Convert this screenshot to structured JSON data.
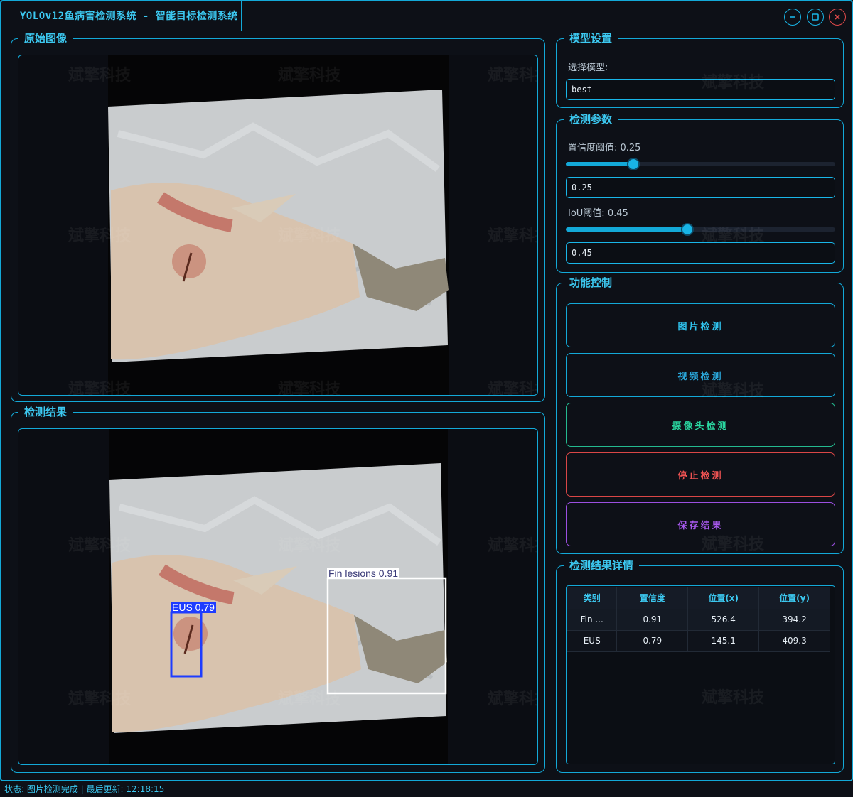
{
  "window": {
    "title": "YOLOv12鱼病害检测系统 - 智能目标检测系统"
  },
  "original_panel": {
    "title": "原始图像"
  },
  "result_panel": {
    "title": "检测结果",
    "detections": [
      {
        "label": "EUS 0.79",
        "color": "#1e3cff"
      },
      {
        "label": "Fin lesions 0.91",
        "color": "#ffffff"
      }
    ]
  },
  "model_settings": {
    "title": "模型设置",
    "select_label": "选择模型:",
    "selected_model": "best"
  },
  "detect_params": {
    "title": "检测参数",
    "conf_label": "置信度阈值: 0.25",
    "conf_value": "0.25",
    "conf_fraction": 0.25,
    "iou_label": "IoU阈值: 0.45",
    "iou_value": "0.45",
    "iou_fraction": 0.45
  },
  "controls": {
    "title": "功能控制",
    "buttons": [
      {
        "label": "图片检测",
        "color": "#2fc4f0"
      },
      {
        "label": "视频检测",
        "color": "#2aa6d9"
      },
      {
        "label": "摄像头检测",
        "color": "#2ad6a0"
      },
      {
        "label": "停止检测",
        "color": "#ee5252"
      },
      {
        "label": "保存结果",
        "color": "#a95af0"
      }
    ]
  },
  "details": {
    "title": "检测结果详情",
    "columns": [
      "类别",
      "置信度",
      "位置(x)",
      "位置(y)"
    ],
    "rows": [
      [
        "Fin ...",
        "0.91",
        "526.4",
        "394.2"
      ],
      [
        "EUS",
        "0.79",
        "145.1",
        "409.3"
      ]
    ]
  },
  "status": {
    "text": "状态: 图片检测完成 | 最后更新: 12:18:15"
  },
  "watermark": "斌擎科技",
  "colors": {
    "accent": "#13a9d8",
    "background": "#0d1017",
    "stop": "#ee5252",
    "save": "#a95af0",
    "camera": "#2ad6a0"
  }
}
